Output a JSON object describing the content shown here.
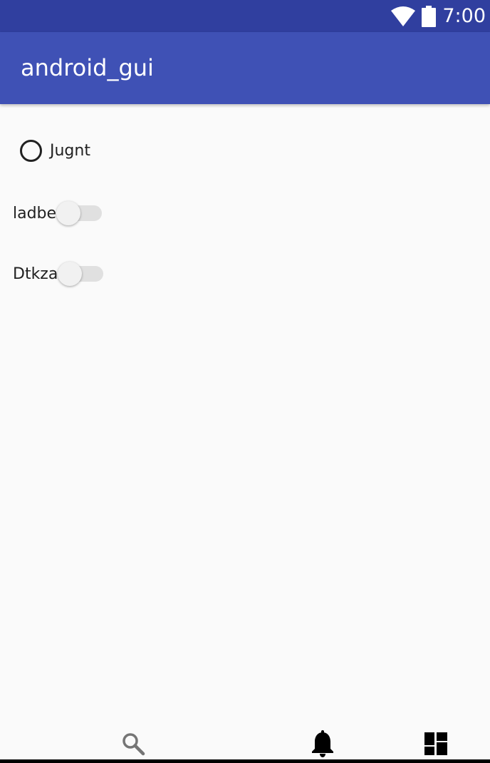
{
  "status_bar": {
    "time": "7:00",
    "icons": [
      "wifi-icon",
      "battery-icon"
    ],
    "background": "#303f9f"
  },
  "app_bar": {
    "title": "android_gui",
    "background": "#3f51b5"
  },
  "controls": {
    "radio": {
      "label": "Jugnt",
      "checked": false
    },
    "switches": [
      {
        "label": "ladbe",
        "on": false
      },
      {
        "label": "Dtkza",
        "on": false
      }
    ]
  },
  "bottom_nav": {
    "items": [
      "search-icon",
      "bell-icon",
      "dashboard-icon"
    ]
  }
}
